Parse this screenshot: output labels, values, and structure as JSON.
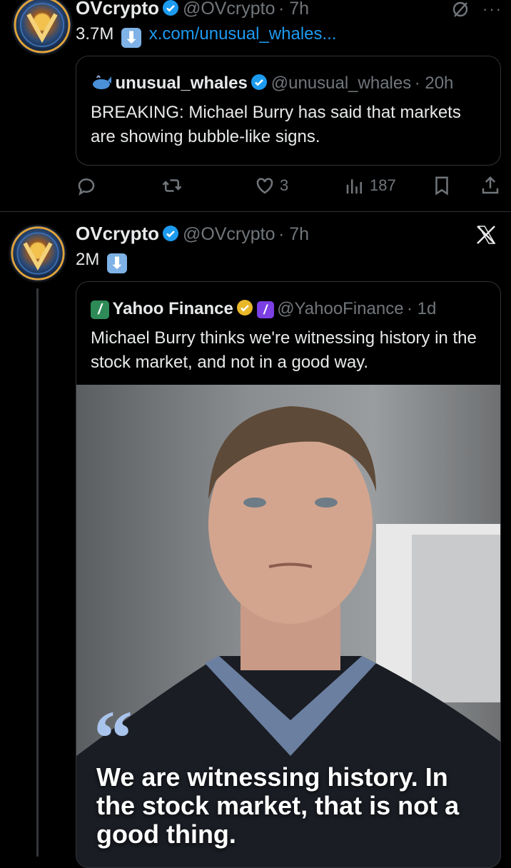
{
  "tweet1": {
    "author_name": "OVcrypto",
    "author_handle": "@OVcrypto",
    "time": "· 7h",
    "views_text": "3.7M",
    "link_text": "x.com/unusual_whales...",
    "quote": {
      "name": "unusual_whales",
      "handle": "@unusual_whales",
      "time": "· 20h",
      "text": "BREAKING: Michael Burry has said that markets are showing bubble-like signs."
    },
    "actions": {
      "reply": "",
      "retweet": "",
      "like_count": "3",
      "views_count": "187"
    }
  },
  "tweet2": {
    "author_name": "OVcrypto",
    "author_handle": "@OVcrypto",
    "time": "· 7h",
    "views_text": "2M",
    "quote": {
      "name": "Yahoo Finance",
      "handle": "@YahooFinance",
      "time": "· 1d",
      "text": "Michael Burry thinks we're witnessing history in the stock market, and not in a good way.",
      "image_quote_mark": "“",
      "image_quote_text": "We are witnessing history. In the stock market, that is not a good thing."
    }
  },
  "icons": {
    "more": "more-icon",
    "grok": "grok-icon",
    "x_logo": "x-logo-icon"
  },
  "colors": {
    "background": "#000000",
    "text": "#e7e9ea",
    "muted": "#71767b",
    "link": "#1d9bf0",
    "verified": "#1d9bf0",
    "gold_verified": "#e8b829"
  }
}
